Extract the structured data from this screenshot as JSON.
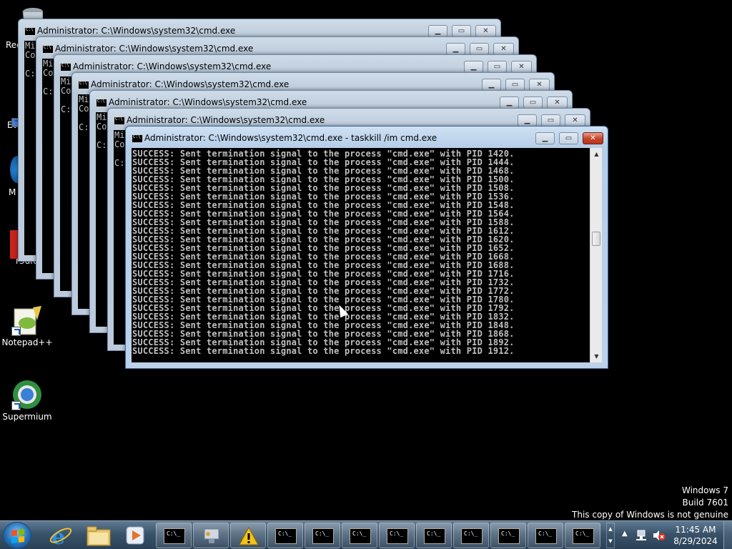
{
  "desktop": {
    "icons": [
      {
        "label": "Rec",
        "icon": "recycle-bin-icon"
      },
      {
        "label": "Eve",
        "icon": "app-icon"
      },
      {
        "label": "M",
        "icon": "app-icon"
      },
      {
        "label": "r3dfo",
        "icon": "app-icon"
      },
      {
        "label": "Notepad++",
        "icon": "notepadpp-icon"
      },
      {
        "label": "Supermium",
        "icon": "supermium-icon"
      }
    ]
  },
  "windows": {
    "background_title": "Administrator: C:\\Windows\\system32\\cmd.exe",
    "peek_lines": [
      "Mi\nCo\n\nC:",
      "Mi\nCo\n\nC:",
      "Mi\nCo\n\nC:",
      "Mi\nCo\n\nC:",
      "Mi\nCo\n\nC:",
      "Mi\nCo\n\nC:"
    ],
    "active": {
      "title": "Administrator: C:\\Windows\\system32\\cmd.exe - taskkill  /im cmd.exe",
      "minimize": "▁",
      "maximize": "▭",
      "close": "✕",
      "console_lines": [
        "SUCCESS: Sent termination signal to the process \"cmd.exe\" with PID 1420.",
        "SUCCESS: Sent termination signal to the process \"cmd.exe\" with PID 1444.",
        "SUCCESS: Sent termination signal to the process \"cmd.exe\" with PID 1468.",
        "SUCCESS: Sent termination signal to the process \"cmd.exe\" with PID 1500.",
        "SUCCESS: Sent termination signal to the process \"cmd.exe\" with PID 1508.",
        "SUCCESS: Sent termination signal to the process \"cmd.exe\" with PID 1536.",
        "SUCCESS: Sent termination signal to the process \"cmd.exe\" with PID 1548.",
        "SUCCESS: Sent termination signal to the process \"cmd.exe\" with PID 1564.",
        "SUCCESS: Sent termination signal to the process \"cmd.exe\" with PID 1588.",
        "SUCCESS: Sent termination signal to the process \"cmd.exe\" with PID 1612.",
        "SUCCESS: Sent termination signal to the process \"cmd.exe\" with PID 1620.",
        "SUCCESS: Sent termination signal to the process \"cmd.exe\" with PID 1652.",
        "SUCCESS: Sent termination signal to the process \"cmd.exe\" with PID 1668.",
        "SUCCESS: Sent termination signal to the process \"cmd.exe\" with PID 1688.",
        "SUCCESS: Sent termination signal to the process \"cmd.exe\" with PID 1716.",
        "SUCCESS: Sent termination signal to the process \"cmd.exe\" with PID 1732.",
        "SUCCESS: Sent termination signal to the process \"cmd.exe\" with PID 1772.",
        "SUCCESS: Sent termination signal to the process \"cmd.exe\" with PID 1780.",
        "SUCCESS: Sent termination signal to the process \"cmd.exe\" with PID 1792.",
        "SUCCESS: Sent termination signal to the process \"cmd.exe\" with PID 1832.",
        "SUCCESS: Sent termination signal to the process \"cmd.exe\" with PID 1848.",
        "SUCCESS: Sent termination signal to the process \"cmd.exe\" with PID 1868.",
        "SUCCESS: Sent termination signal to the process \"cmd.exe\" with PID 1892.",
        "SUCCESS: Sent termination signal to the process \"cmd.exe\" with PID 1912."
      ]
    }
  },
  "watermark": {
    "line1": "Windows 7",
    "line2": "Build 7601",
    "line3": "This copy of Windows is not genuine"
  },
  "taskbar": {
    "pinned": [
      "internet-explorer-icon",
      "explorer-folder-icon",
      "media-player-icon"
    ],
    "running": [
      "cmd-icon",
      "network-tool-icon",
      "warning-icon",
      "cmd-icon",
      "cmd-icon",
      "cmd-icon",
      "cmd-icon",
      "cmd-icon",
      "cmd-icon",
      "cmd-icon",
      "cmd-icon",
      "cmd-icon"
    ],
    "clock": {
      "time": "11:45 AM",
      "date": "8/29/2024"
    },
    "tray_arrow": "▲"
  },
  "colors": {
    "console_text": "#c0c0c0",
    "taskbar": "#3a536a",
    "close_button": "#c9462c"
  }
}
